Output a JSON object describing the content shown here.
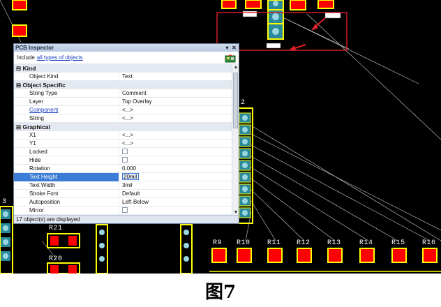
{
  "caption": "图7",
  "designators": {
    "r21": "R21",
    "r20": "R20",
    "r9": "R9",
    "r10": "R10",
    "r11": "R11",
    "r12": "R12",
    "r13": "R13",
    "r14": "R14",
    "r15": "R15",
    "r16": "R16",
    "p2": "2",
    "p3": "3"
  },
  "colors": {
    "pcb_bg": "#000000",
    "pad_red": "#ff0000",
    "overlay_yellow": "#ffff00",
    "via_teal": "#2a8a9a",
    "highlight_box": "#e0202a"
  },
  "inspector": {
    "title": "PCB Inspector",
    "include_label": "Include",
    "include_link": "all types of objects",
    "sections": {
      "kind": "Kind",
      "object_specific": "Object Specific",
      "graphical": "Graphical"
    },
    "rows": {
      "object_kind": {
        "label": "Object Kind",
        "value": "Text"
      },
      "string_type": {
        "label": "String Type",
        "value": "Comment"
      },
      "layer": {
        "label": "Layer",
        "value": "Top Overlay"
      },
      "component": {
        "label": "Component",
        "value": "<...>"
      },
      "string": {
        "label": "String",
        "value": "<...>"
      },
      "x1": {
        "label": "X1",
        "value": "<...>"
      },
      "y1": {
        "label": "Y1",
        "value": "<...>"
      },
      "locked": {
        "label": "Locked",
        "value": ""
      },
      "hide": {
        "label": "Hide",
        "value": ""
      },
      "rotation": {
        "label": "Rotation",
        "value": "0.000"
      },
      "text_height": {
        "label": "Text Height",
        "value": "20mil"
      },
      "text_width": {
        "label": "Text Width",
        "value": "3mil"
      },
      "stroke_font": {
        "label": "Stroke Font",
        "value": "Default"
      },
      "autoposition": {
        "label": "Autoposition",
        "value": "Left-Below"
      },
      "mirror": {
        "label": "Mirror",
        "value": ""
      }
    },
    "status": "17 object(s) are displayed",
    "collapse_symbol": "⊟",
    "pin_symbol": "▾",
    "close_symbol": "✕",
    "scroll_up": "▲",
    "scroll_down": "▼"
  }
}
